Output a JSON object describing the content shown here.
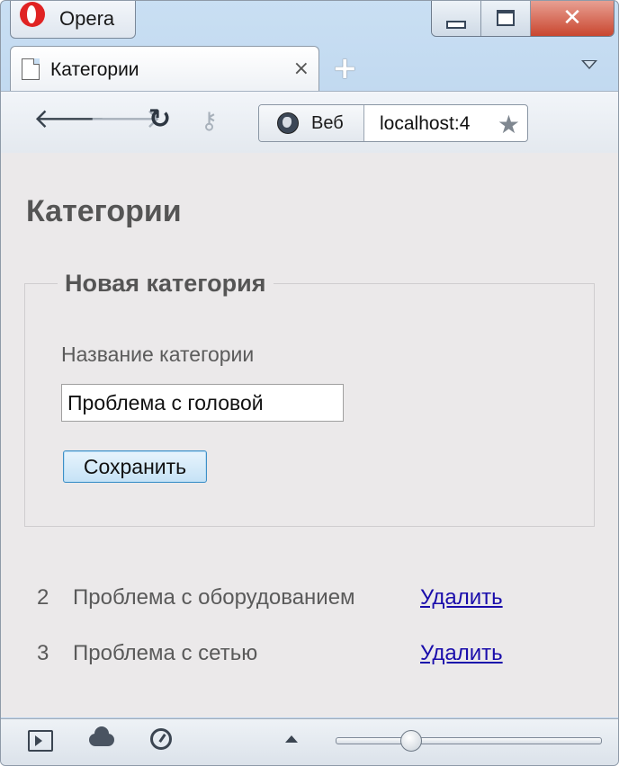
{
  "browser": {
    "app_name": "Opera",
    "tab": {
      "title": "Категории",
      "close_glyph": "×"
    },
    "new_tab_glyph": "+",
    "address_bar": {
      "mode_label": "Веб",
      "url": "localhost:4"
    },
    "icons": {
      "back": "arrow-left",
      "forward": "arrow-right",
      "reload": "reload",
      "key": "key",
      "bookmark": "star"
    }
  },
  "page": {
    "title": "Категории",
    "form": {
      "legend": "Новая категория",
      "name_label": "Название категории",
      "name_value": "Проблема с головой",
      "save_label": "Сохранить"
    },
    "categories": [
      {
        "id": "2",
        "name": "Проблема с оборудованием",
        "delete_label": "Удалить"
      },
      {
        "id": "3",
        "name": "Проблема с сетью",
        "delete_label": "Удалить"
      }
    ]
  },
  "statusbar": {
    "zoom_fraction": 0.28
  },
  "colors": {
    "link": "#1a0dab",
    "opera_red": "#e02323",
    "close_button": "#c9462f",
    "page_bg": "#ebe9ea"
  }
}
